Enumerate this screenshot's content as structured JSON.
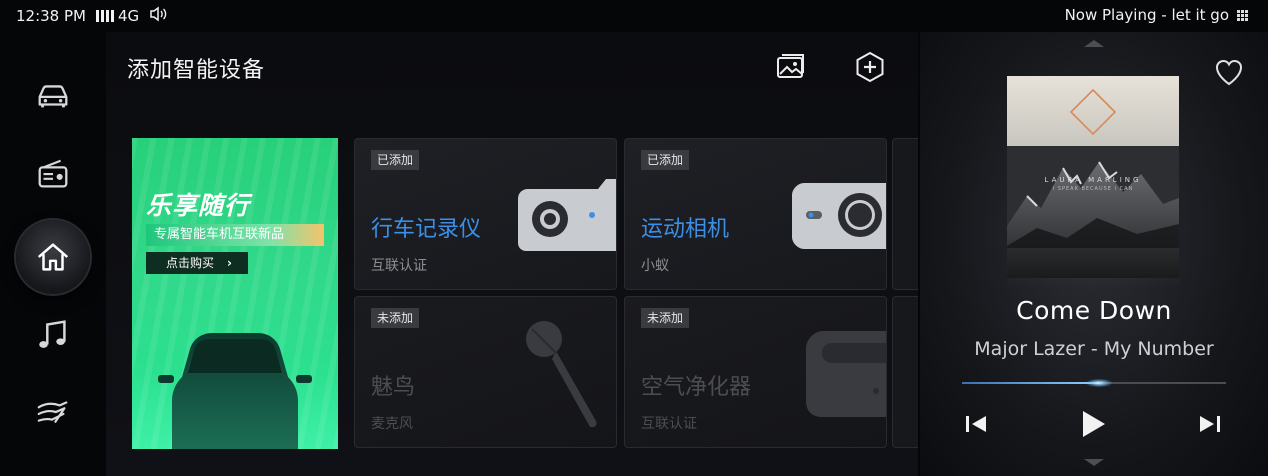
{
  "status_bar": {
    "time": "12:38 PM",
    "network": "4G",
    "now_playing": "Now Playing - let it go"
  },
  "side_nav": {
    "items": [
      {
        "name": "car"
      },
      {
        "name": "radio"
      },
      {
        "name": "home",
        "active": true
      },
      {
        "name": "music"
      },
      {
        "name": "air-conditioning"
      }
    ]
  },
  "main": {
    "title": "添加智能设备",
    "banner": {
      "title": "乐享随行",
      "subtitle": "专属智能车机互联新品",
      "button": "点击购买"
    },
    "cards": [
      {
        "badge": "已添加",
        "name": "行车记录仪",
        "sub": "互联认证",
        "icon": "dashcam-icon"
      },
      {
        "badge": "已添加",
        "name": "运动相机",
        "sub": "小蚁",
        "icon": "action-camera-icon"
      },
      {
        "badge": "未添加",
        "name": "魅鸟",
        "sub": "麦克风",
        "icon": "microphone-icon"
      },
      {
        "badge": "未添加",
        "name": "空气净化器",
        "sub": "互联认证",
        "icon": "air-purifier-icon"
      }
    ]
  },
  "media": {
    "song_title": "Come Down",
    "artist_line": "Major Lazer - My Number",
    "album_text": "LAURA MARLING",
    "album_subtext": "I SPEAK BECAUSE I CAN",
    "progress": 0.52
  },
  "colors": {
    "accent_blue": "#3b8fe8",
    "banner_green": "#2fd886"
  }
}
